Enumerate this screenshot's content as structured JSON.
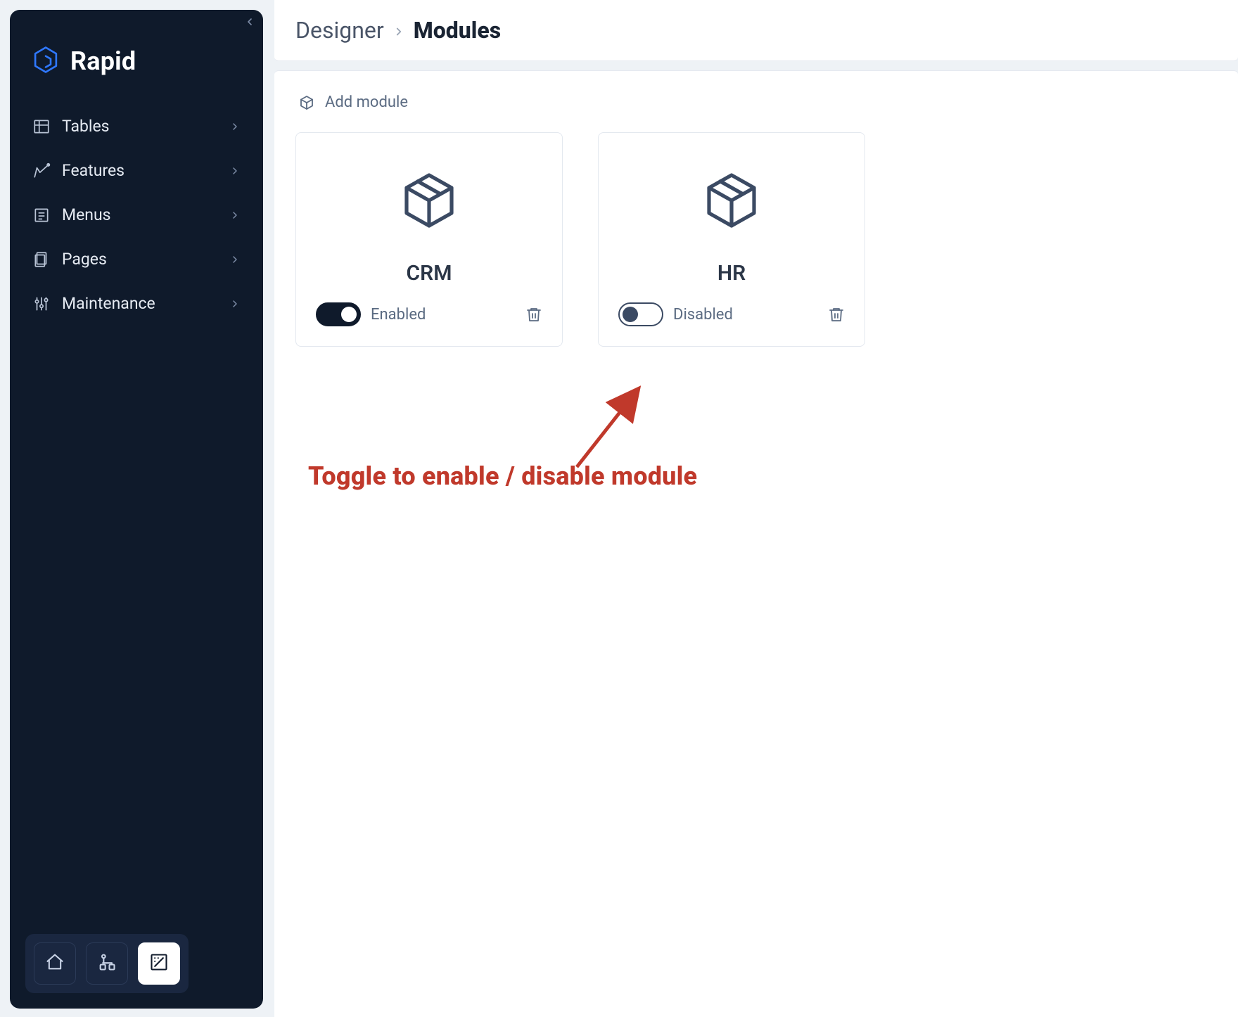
{
  "brand": {
    "name": "Rapid"
  },
  "sidebar": {
    "items": [
      {
        "label": "Tables",
        "name": "sidebar-item-tables"
      },
      {
        "label": "Features",
        "name": "sidebar-item-features"
      },
      {
        "label": "Menus",
        "name": "sidebar-item-menus"
      },
      {
        "label": "Pages",
        "name": "sidebar-item-pages"
      },
      {
        "label": "Maintenance",
        "name": "sidebar-item-maintenance"
      }
    ]
  },
  "breadcrumb": {
    "parent": "Designer",
    "current": "Modules"
  },
  "actions": {
    "add_module": "Add module"
  },
  "modules": [
    {
      "title": "CRM",
      "enabled": true,
      "state_label": "Enabled"
    },
    {
      "title": "HR",
      "enabled": false,
      "state_label": "Disabled"
    }
  ],
  "annotation": {
    "text": "Toggle to enable / disable module"
  }
}
